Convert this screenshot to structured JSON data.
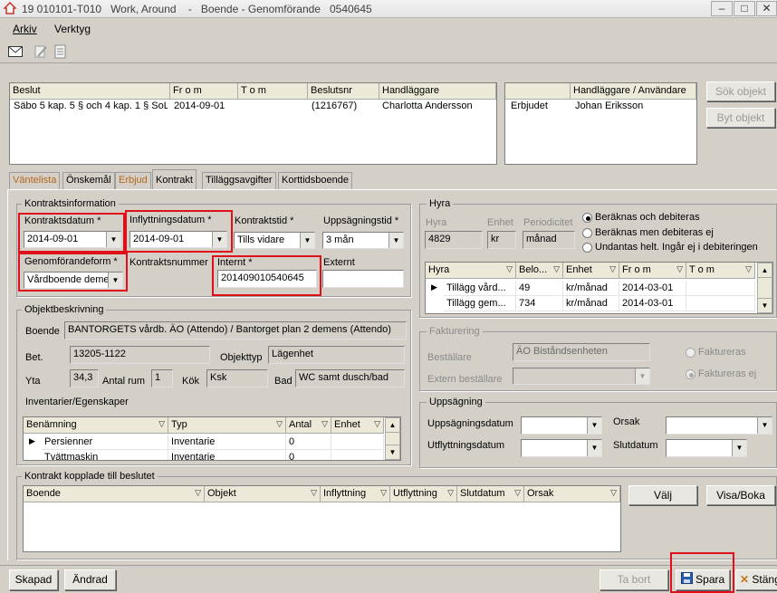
{
  "window": {
    "title": "19 010101-T010   Work, Around    -   Boende - Genomförande   0540645"
  },
  "menu": {
    "arkiv": "Arkiv",
    "verktyg": "Verktyg"
  },
  "beslut_table": {
    "headers": [
      "Beslut",
      "Fr o m",
      "T o m",
      "Beslutsnr",
      "Handläggare"
    ],
    "row": [
      "Säbo 5 kap. 5 § och 4 kap. 1 § SoL",
      "2014-09-01",
      "",
      "(1216767)",
      "Charlotta Andersson"
    ]
  },
  "handlaggare_table": {
    "headers": [
      "",
      "Handläggare / Användare"
    ],
    "row": [
      "Erbjudet",
      "Johan Eriksson"
    ]
  },
  "buttons": {
    "sok_objekt": "Sök objekt",
    "byt_objekt": "Byt objekt",
    "valj": "Välj",
    "visa_boka": "Visa/Boka",
    "skapad": "Skapad",
    "andrad": "Ändrad",
    "ta_bort": "Ta bort",
    "spara": "Spara",
    "stang": "Stäng"
  },
  "tabs": [
    "Väntelista",
    "Önskemål",
    "Erbjud",
    "Kontrakt",
    "Tilläggsavgifter",
    "Korttidsboende"
  ],
  "kontrakt": {
    "legend": "Kontraktsinformation",
    "kontraktsdatum_label": "Kontraktsdatum *",
    "kontraktsdatum": "2014-09-01",
    "inflyttningsdatum_label": "Inflyttningsdatum *",
    "inflyttningsdatum": "2014-09-01",
    "kontraktstid_label": "Kontraktstid *",
    "kontraktstid": "Tills vidare",
    "uppsagningstid_label": "Uppsägningstid *",
    "uppsagningstid": "3 mån",
    "genomforandeform_label": "Genomförandeform *",
    "genomforandeform": "Vårdboende deme",
    "kontraktsnummer_label": "Kontraktsnummer",
    "internt_label": "Internt *",
    "internt": "201409010540645",
    "externt_label": "Externt",
    "externt": ""
  },
  "objekt": {
    "legend": "Objektbeskrivning",
    "boende_label": "Boende",
    "boende": "BANTORGETS vårdb. ÄO (Attendo) / Bantorget plan 2 demens (Attendo)",
    "bet_label": "Bet.",
    "bet": "13205-1122",
    "objekttyp_label": "Objekttyp",
    "objekttyp": "Lägenhet",
    "yta_label": "Yta",
    "yta": "34,3",
    "antal_rum_label": "Antal rum",
    "antal_rum": "1",
    "kok_label": "Kök",
    "kok": "Ksk",
    "bad_label": "Bad",
    "bad": "WC samt dusch/bad",
    "inventarier_label": "Inventarier/Egenskaper"
  },
  "inventarier_table": {
    "headers": [
      "Benämning",
      "Typ",
      "Antal",
      "Enhet"
    ],
    "rows": [
      [
        "Persienner",
        "Inventarie",
        "0",
        ""
      ],
      [
        "Tvättmaskin",
        "Inventarie",
        "0",
        ""
      ]
    ]
  },
  "hyra": {
    "legend": "Hyra",
    "hyra_label": "Hyra",
    "hyra": "4829",
    "enhet_label": "Enhet",
    "enhet": "kr",
    "periodicitet_label": "Periodicitet",
    "periodicitet": "månad",
    "radio1": "Beräknas och debiteras",
    "radio2": "Beräknas men debiteras ej",
    "radio3": "Undantas helt. Ingår ej i debiteringen"
  },
  "hyra_table": {
    "headers": [
      "Hyra",
      "Belo...",
      "Enhet",
      "Fr o m",
      "T o m"
    ],
    "rows": [
      [
        "Tillägg vård...",
        "49",
        "kr/månad",
        "2014-03-01",
        ""
      ],
      [
        "Tillägg gem...",
        "734",
        "kr/månad",
        "2014-03-01",
        ""
      ]
    ]
  },
  "fakturering": {
    "legend": "Fakturering",
    "bestallare_label": "Beställare",
    "bestallare": "ÄO Biståndsenheten",
    "extern_label": "Extern beställare",
    "radio1": "Faktureras",
    "radio2": "Faktureras ej"
  },
  "uppsagning": {
    "legend": "Uppsägning",
    "uppsagningsdatum_label": "Uppsägningsdatum",
    "utflyttningsdatum_label": "Utflyttningsdatum",
    "orsak_label": "Orsak",
    "slutdatum_label": "Slutdatum"
  },
  "kopplade": {
    "legend": "Kontrakt kopplade till beslutet",
    "headers": [
      "Boende",
      "Objekt",
      "Inflyttning",
      "Utflyttning",
      "Slutdatum",
      "Orsak"
    ]
  }
}
